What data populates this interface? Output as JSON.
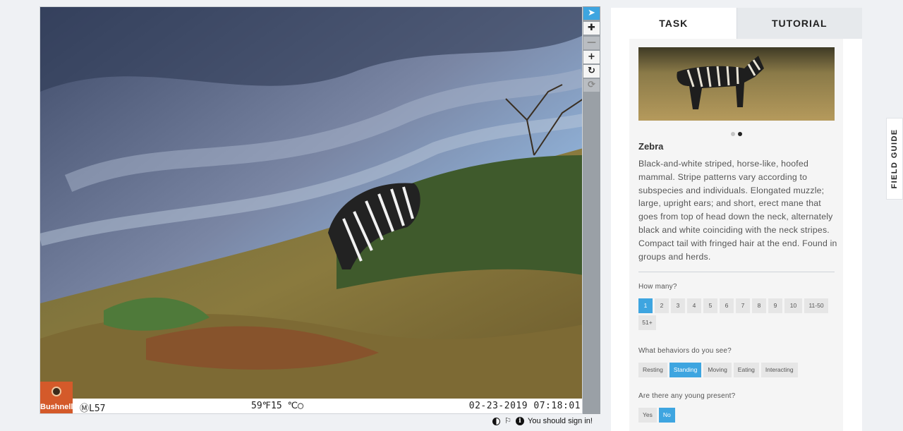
{
  "viewer": {
    "camera_brand": "Bushnell",
    "camera_id": "ⓂL57",
    "temperature": "59℉15 ℃◯",
    "datetime": "02-23-2019 07:18:01"
  },
  "toolbar": {
    "tools": [
      {
        "icon": "pointer-icon",
        "glyph": "➤",
        "state": "active"
      },
      {
        "icon": "move-icon",
        "glyph": "✚",
        "state": "normal"
      },
      {
        "icon": "zoom-out-icon",
        "glyph": "—",
        "state": "disabled"
      },
      {
        "icon": "zoom-in-icon",
        "glyph": "+",
        "state": "normal"
      },
      {
        "icon": "rotate-icon",
        "glyph": "↻",
        "state": "normal"
      },
      {
        "icon": "reset-icon",
        "glyph": "⟳",
        "state": "disabled"
      }
    ]
  },
  "footer": {
    "sign_in_text": "You should sign in!"
  },
  "tabs": {
    "task": "TASK",
    "tutorial": "TUTORIAL"
  },
  "species": {
    "name": "Zebra",
    "description": "Black-and-white striped, horse-like, hoofed mammal. Stripe patterns vary according to subspecies and individuals. Elongated muzzle; large, upright ears; and short, erect mane that goes from top of head down the neck, alternately black and white coinciding with the neck stripes. Compact tail with fringed hair at the end. Found in groups and herds."
  },
  "questions": {
    "how_many": {
      "label": "How many?",
      "options": [
        "1",
        "2",
        "3",
        "4",
        "5",
        "6",
        "7",
        "8",
        "9",
        "10",
        "11-50",
        "51+"
      ],
      "selected": "1"
    },
    "behaviors": {
      "label": "What behaviors do you see?",
      "options": [
        "Resting",
        "Standing",
        "Moving",
        "Eating",
        "Interacting"
      ],
      "selected": [
        "Standing"
      ]
    },
    "young": {
      "label": "Are there any young present?",
      "options": [
        "Yes",
        "No"
      ],
      "selected": "No"
    }
  },
  "field_guide": {
    "label": "FIELD GUIDE"
  },
  "colors": {
    "accent": "#3ea5e0",
    "camera_logo": "#d45a2a"
  }
}
